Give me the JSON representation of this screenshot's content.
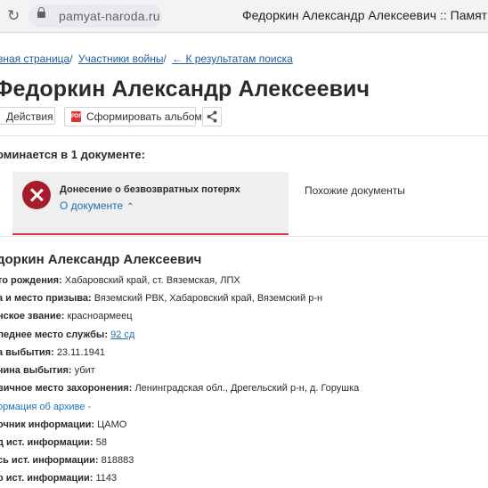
{
  "browser": {
    "url": "pamyat-naroda.ru",
    "tab_title": "Федоркин Александр Алексеевич :: Память на"
  },
  "breadcrumb": {
    "home": "вная страница",
    "participants": "Участники войны",
    "back": "← К результатам поиска"
  },
  "page_title": "Федоркин Александр Алексеевич",
  "actions": {
    "actions_label": "Действия",
    "album_label": "Сформировать альбом",
    "pdf_icon_text": "PDF"
  },
  "mentioned_heading": "оминается в 1 документе:",
  "document": {
    "title": "Донесение о безвозвратных потерях",
    "link": "О документе",
    "similar": "Похожие документы"
  },
  "person": {
    "name": "доркин Александр Алексеевич",
    "fields": [
      {
        "label": "то рождения:",
        "value": "Хабаровский край, ст. Вяземская, ЛПХ"
      },
      {
        "label": "а и место призыва:",
        "value": "Вяземский РВК, Хабаровский край, Вяземский р-н"
      },
      {
        "label": "нское звание:",
        "value": "красноармеец"
      },
      {
        "label": "леднее место службы:",
        "link": "92 сд"
      },
      {
        "label": "а выбытия:",
        "value": "23.11.1941"
      },
      {
        "label": "чина выбытия:",
        "value": "убит"
      },
      {
        "label": "вичное место захоронения:",
        "value": "Ленинградская обл., Дрегельский р-н, д. Горушка"
      }
    ],
    "archive_link": "ормация об архиве -",
    "archive_fields": [
      {
        "label": "очник информации:",
        "value": "ЦАМО"
      },
      {
        "label": "д ист. информации:",
        "value": "58"
      },
      {
        "label": "сь ист. информации:",
        "value": "818883"
      },
      {
        "label": "о ист. информации:",
        "value": "1143"
      }
    ]
  },
  "colors": {
    "link": "#1f5b96",
    "accent_red": "#d9353d",
    "doc_icon": "#a71c2b"
  }
}
